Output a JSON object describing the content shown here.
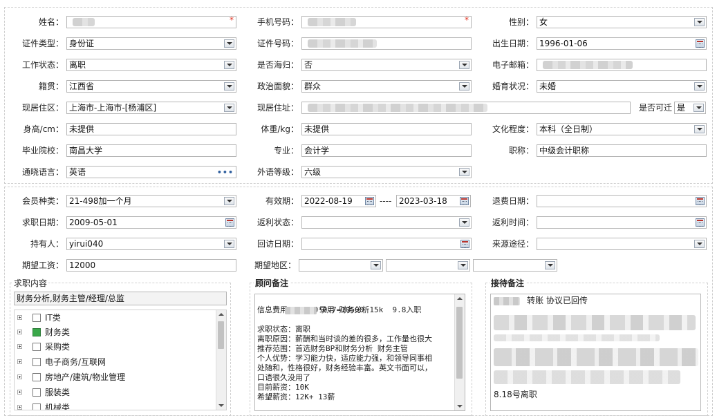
{
  "section1": {
    "name": {
      "label": "姓名：",
      "value": "",
      "required": "*"
    },
    "phone": {
      "label": "手机号码：",
      "value": "",
      "required": "*"
    },
    "gender": {
      "label": "性别：",
      "value": "女"
    },
    "id_type": {
      "label": "证件类型：",
      "value": "身份证"
    },
    "id_number": {
      "label": "证件号码：",
      "value": ""
    },
    "birth_date": {
      "label": "出生日期：",
      "value": "1996-01-06"
    },
    "work_status": {
      "label": "工作状态：",
      "value": "离职"
    },
    "overseas_returnee": {
      "label": "是否海归：",
      "value": "否"
    },
    "email": {
      "label": "电子邮箱：",
      "value": ""
    },
    "native_place": {
      "label": "籍贯：",
      "value": "江西省"
    },
    "political_status": {
      "label": "政治面貌：",
      "value": "群众"
    },
    "marital_status": {
      "label": "婚育状况：",
      "value": "未婚"
    },
    "residence_area": {
      "label": "现居住区：",
      "value": "上海市-上海市-[杨浦区]"
    },
    "residence_address": {
      "label": "现居住址：",
      "value": ""
    },
    "relocatable": {
      "label": "是否可迁",
      "value": "是"
    },
    "height": {
      "label": "身高/cm：",
      "value": "未提供"
    },
    "weight": {
      "label": "体重/kg：",
      "value": "未提供"
    },
    "education": {
      "label": "文化程度：",
      "value": "本科（全日制）"
    },
    "school": {
      "label": "毕业院校：",
      "value": "南昌大学"
    },
    "major": {
      "label": "专业：",
      "value": "会计学"
    },
    "title": {
      "label": "职称：",
      "value": "中级会计职称"
    },
    "languages": {
      "label": "通晓语言：",
      "value": "英语"
    },
    "language_level": {
      "label": "外语等级：",
      "value": "六级"
    }
  },
  "section2": {
    "member_type": {
      "label": "会员种类：",
      "value": "21-498加一个月"
    },
    "validity": {
      "label": "有效期：",
      "start": "2022-08-19",
      "separator": "----",
      "end": "2023-03-18"
    },
    "refund_date": {
      "label": "退费日期：",
      "value": ""
    },
    "job_seek_date": {
      "label": "求职日期：",
      "value": "2009-05-01"
    },
    "rebate_status": {
      "label": "返利状态：",
      "value": ""
    },
    "rebate_time": {
      "label": "返利时间：",
      "value": ""
    },
    "holder": {
      "label": "持有人：",
      "value": "yirui040"
    },
    "return_visit_date": {
      "label": "回访日期：",
      "value": ""
    },
    "source": {
      "label": "来源途径：",
      "value": ""
    },
    "expected_salary": {
      "label": "期望工资：",
      "value": "12000"
    },
    "expected_area": {
      "label": "期望地区：",
      "values": [
        "",
        "",
        ""
      ]
    }
  },
  "job_content": {
    "title": "求职内容",
    "selected": "财务分析,财务主管/经理/总监",
    "tree": [
      {
        "label": "IT类",
        "checked": false
      },
      {
        "label": "财务类",
        "checked": true
      },
      {
        "label": "采购类",
        "checked": false
      },
      {
        "label": "电子商务/互联网",
        "checked": false
      },
      {
        "label": "房地产/建筑/物业管理",
        "checked": false
      },
      {
        "label": "服装类",
        "checked": false
      },
      {
        "label": "机械类",
        "checked": false
      }
    ]
  },
  "consultant_notes": {
    "title": "顾问备注",
    "lines": [
      "录用 财务分析15k  9.8入职",
      "信息费用：15000*0.7=10500",
      "",
      "求职状态：离职",
      "离职原因：薪酬和当时谈的差的很多，工作量也很大",
      "推荐范围：首选财务BP和财务分析 财务主管",
      "个人优势：学习能力快，适应能力强，和领导同事相",
      "处随和，性格很好，财务经验丰富。英文书面可以，",
      "口语很久没用了",
      "目前薪资：10K",
      "希望薪资：12K+ 13薪"
    ]
  },
  "reception_notes": {
    "title": "接待备注",
    "first_line": "转账 协议已回传",
    "last_line": "8.18号离职"
  }
}
